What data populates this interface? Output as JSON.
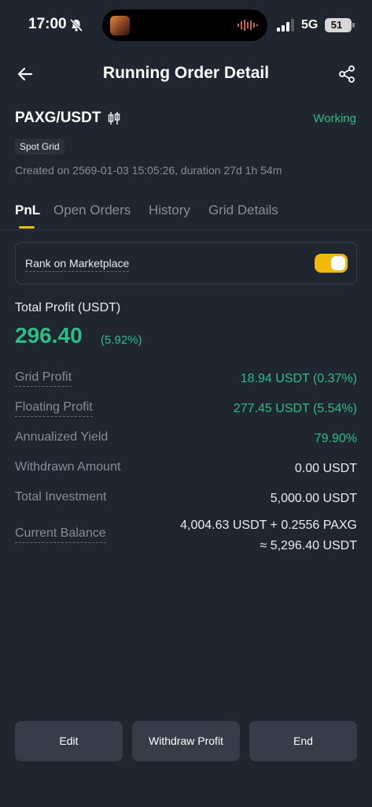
{
  "status_bar": {
    "time": "17:00",
    "network": "5G",
    "battery": "51"
  },
  "header": {
    "title": "Running Order Detail"
  },
  "order": {
    "pair": "PAXG/USDT",
    "status": "Working",
    "badge": "Spot Grid",
    "created": "Created on 2569-01-03 15:05:26, duration 27d 1h 54m"
  },
  "tabs": [
    {
      "label": "PnL",
      "active": true
    },
    {
      "label": "Open Orders"
    },
    {
      "label": "History"
    },
    {
      "label": "Grid Details"
    }
  ],
  "rank": {
    "label": "Rank on Marketplace",
    "enabled": true
  },
  "total_profit": {
    "label": "Total Profit (USDT)",
    "value": "296.40",
    "percent": "(5.92%)"
  },
  "rows": [
    {
      "label": "Grid Profit",
      "value": "18.94 USDT (0.37%)"
    },
    {
      "label": "Floating Profit",
      "value": "277.45 USDT (5.54%)"
    },
    {
      "label": "Annualized Yield",
      "value": "79.90%"
    },
    {
      "label": "Withdrawn Amount",
      "value": "0.00 USDT"
    },
    {
      "label": "Total Investment",
      "value": "5,000.00 USDT"
    },
    {
      "label": "Current Balance",
      "value": "4,004.63 USDT + 0.2556 PAXG",
      "value2": "≈ 5,296.40 USDT"
    }
  ],
  "actions": {
    "edit": "Edit",
    "withdraw": "Withdraw Profit",
    "end": "End"
  },
  "colors": {
    "accent": "#f0b90b",
    "positive": "#2ebd85",
    "background": "#1f2630"
  }
}
